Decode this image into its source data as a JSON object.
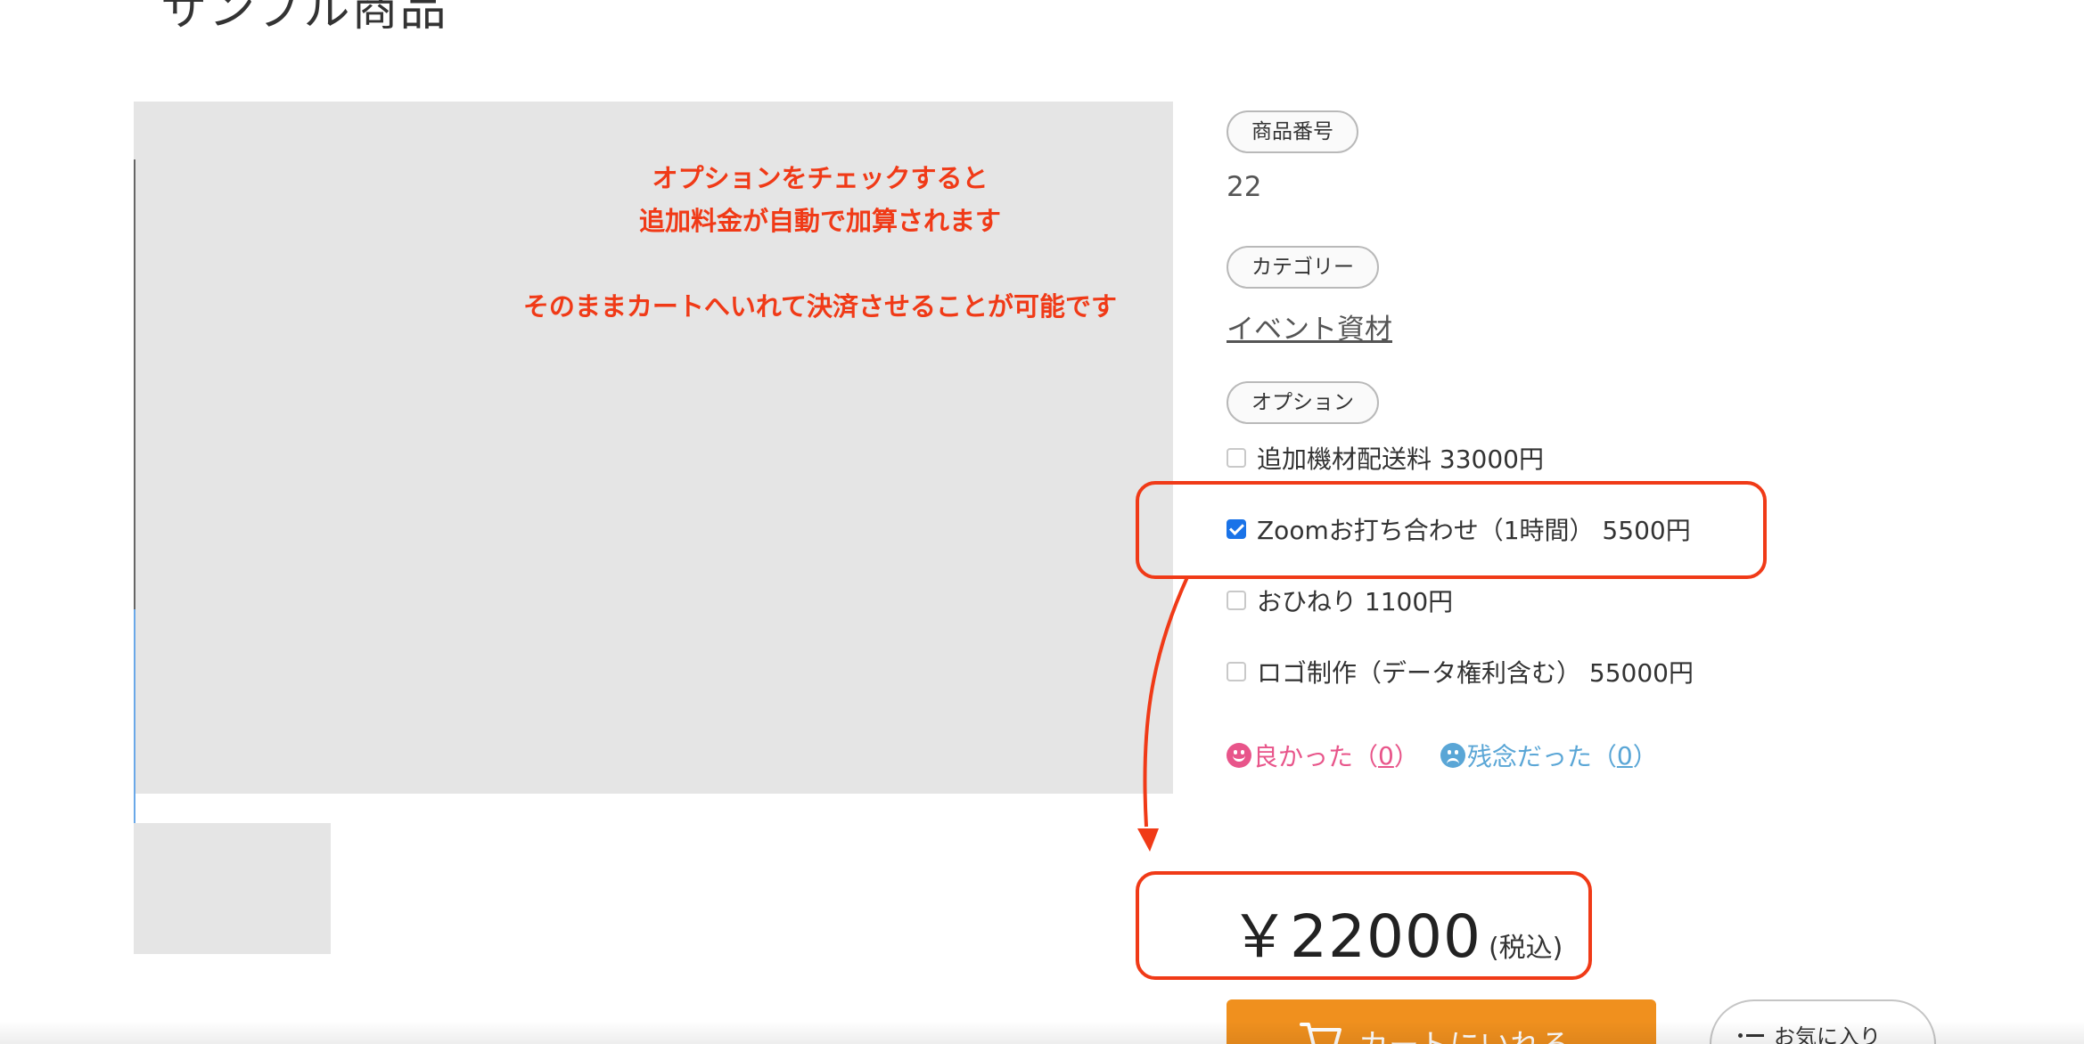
{
  "product": {
    "title": "サンプル商品",
    "sku_label": "商品番号",
    "sku_value": "22",
    "category_label": "カテゴリー",
    "category_value": "イベント資材",
    "options_label": "オプション"
  },
  "annotation": {
    "line1": "オプションをチェックすると",
    "line2": "追加料金が自動で加算されます",
    "line3": "そのままカートへいれて決済させることが可能です"
  },
  "options": [
    {
      "label": "追加機材配送料 33000円",
      "checked": false
    },
    {
      "label": "Zoomお打ち合わせ（1時間） 5500円",
      "checked": true
    },
    {
      "label": "おひねり 1100円",
      "checked": false
    },
    {
      "label": "ロゴ制作（データ権利含む） 55000円",
      "checked": false
    }
  ],
  "feedback": {
    "good_label": "良かった（",
    "good_count": "0",
    "bad_label": "残念だった（",
    "bad_count": "0",
    "close_paren": "）"
  },
  "price": {
    "amount": "￥22000",
    "tax_note": "(税込)"
  },
  "buttons": {
    "cart_label": "カートにいれる",
    "favorite_label": "お気に入り"
  },
  "colors": {
    "annotation_red": "#f03a17",
    "cart_orange": "#f0901e",
    "good_pink": "#e8558a",
    "bad_blue": "#5aa6d6",
    "checkbox_blue": "#1a73e8"
  },
  "icons": {
    "cart": "cart-icon",
    "favorite": "list-icon",
    "good": "smile-icon",
    "bad": "frown-icon"
  }
}
